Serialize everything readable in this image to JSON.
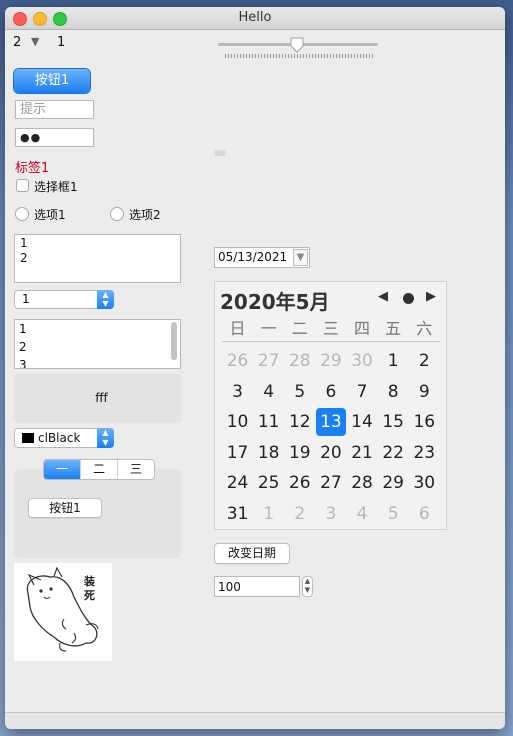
{
  "window": {
    "title": "Hello"
  },
  "top_spin": {
    "value_left": "2",
    "arrow": "▼",
    "value_right": "1"
  },
  "slider": {
    "level_fraction": 0.5
  },
  "buttons": {
    "primary": "按钮1",
    "change_date": "改变日期",
    "tab_button": "按钮1"
  },
  "inputs": {
    "hint_placeholder": "提示",
    "password_mask": "●●",
    "number_value": "100"
  },
  "label1": "标签1",
  "checkbox": {
    "label": "选择框1",
    "checked": false
  },
  "radios": [
    {
      "label": "选项1"
    },
    {
      "label": "选项2"
    }
  ],
  "memo": {
    "lines": [
      "1",
      "2"
    ]
  },
  "combo": {
    "value": "1"
  },
  "listbox": {
    "items": [
      "1",
      "2",
      "3"
    ]
  },
  "panel": {
    "text": "fff"
  },
  "color_combo": {
    "value": "clBlack",
    "swatch": "#000000"
  },
  "tabs": {
    "items": [
      "一",
      "二",
      "三"
    ],
    "active": 0
  },
  "datepicker": {
    "value": "05/13/2021"
  },
  "calendar": {
    "title": "2020年5月",
    "weekdays": [
      "日",
      "一",
      "二",
      "三",
      "四",
      "五",
      "六"
    ],
    "weeks": [
      [
        {
          "d": "26",
          "o": true
        },
        {
          "d": "27",
          "o": true
        },
        {
          "d": "28",
          "o": true
        },
        {
          "d": "29",
          "o": true
        },
        {
          "d": "30",
          "o": true
        },
        {
          "d": "1"
        },
        {
          "d": "2"
        }
      ],
      [
        {
          "d": "3"
        },
        {
          "d": "4"
        },
        {
          "d": "5"
        },
        {
          "d": "6"
        },
        {
          "d": "7"
        },
        {
          "d": "8"
        },
        {
          "d": "9"
        }
      ],
      [
        {
          "d": "10"
        },
        {
          "d": "11"
        },
        {
          "d": "12"
        },
        {
          "d": "13",
          "s": true
        },
        {
          "d": "14"
        },
        {
          "d": "15"
        },
        {
          "d": "16"
        }
      ],
      [
        {
          "d": "17"
        },
        {
          "d": "18"
        },
        {
          "d": "19"
        },
        {
          "d": "20"
        },
        {
          "d": "21"
        },
        {
          "d": "22"
        },
        {
          "d": "23"
        }
      ],
      [
        {
          "d": "24"
        },
        {
          "d": "25"
        },
        {
          "d": "26"
        },
        {
          "d": "27"
        },
        {
          "d": "28"
        },
        {
          "d": "29"
        },
        {
          "d": "30"
        }
      ],
      [
        {
          "d": "31"
        },
        {
          "d": "1",
          "o": true
        },
        {
          "d": "2",
          "o": true
        },
        {
          "d": "3",
          "o": true
        },
        {
          "d": "4",
          "o": true
        },
        {
          "d": "5",
          "o": true
        },
        {
          "d": "6",
          "o": true
        }
      ]
    ]
  },
  "image": {
    "caption": "装死"
  },
  "colors": {
    "accent": "#1a7ff3",
    "label_red": "#d0021b"
  }
}
